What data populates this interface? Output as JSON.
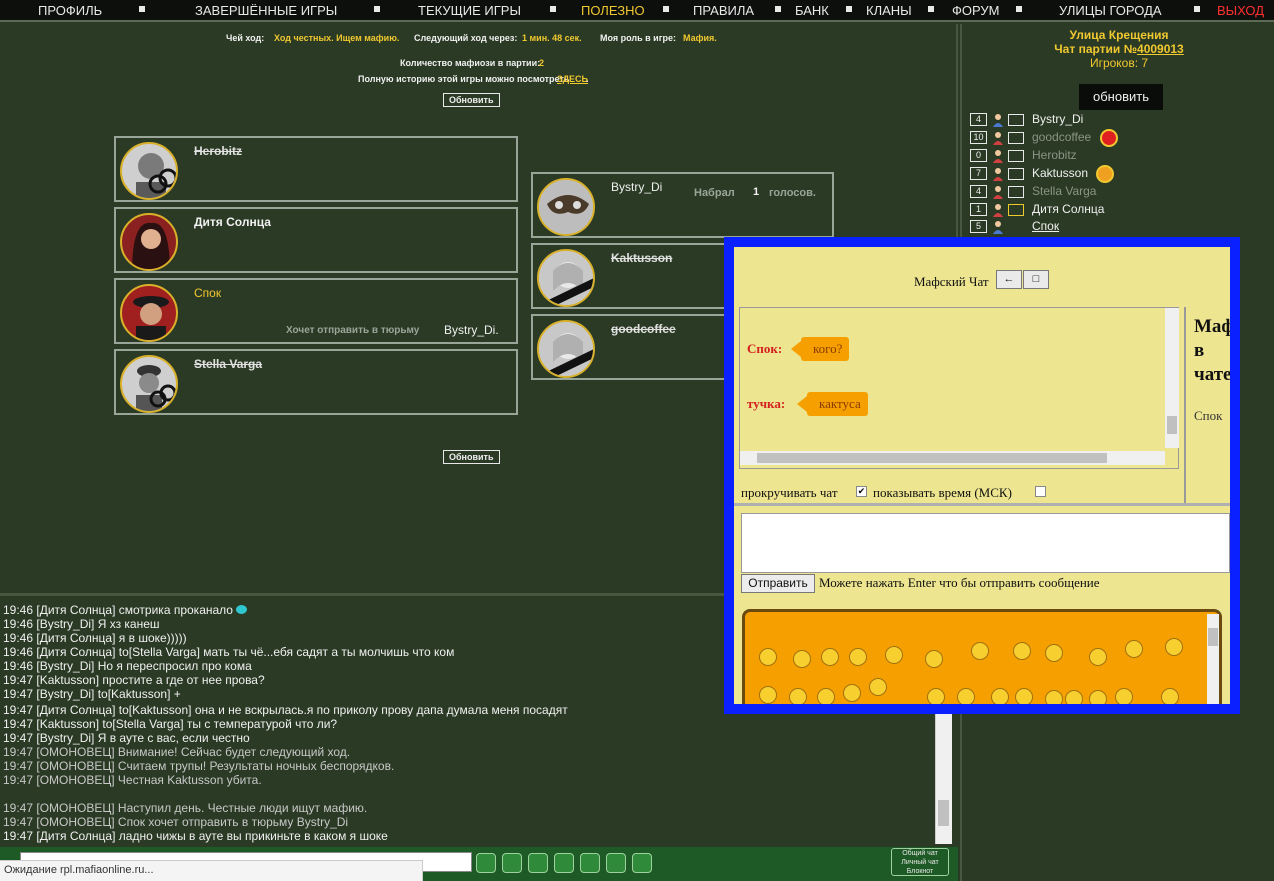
{
  "nav": {
    "items": [
      "ПРОФИЛЬ",
      "ЗАВЕРШЁННЫЕ ИГРЫ",
      "ТЕКУЩИЕ ИГРЫ",
      "ПОЛЕЗНО",
      "ПРАВИЛА",
      "БАНК",
      "КЛАНЫ",
      "ФОРУМ",
      "УЛИЦЫ ГОРОДА",
      "ВЫХОД"
    ],
    "active_color": "#f0c830",
    "exit_color": "#ff3030"
  },
  "game": {
    "turn_label": "Чей ход:",
    "turn_value": "Ход честных. Ищем мафию.",
    "next_label": "Следующий ход через:",
    "next_value": "1 мин. 48 сек.",
    "role_label": "Моя роль в игре:",
    "role_value": "Мафия.",
    "mafia_count_label": "Количество мафиози в партии:",
    "mafia_count_value": "2",
    "history_text": "Полную историю этой игры можно посмотреть",
    "history_link": "ЗДЕСЬ",
    "history_dot": ".",
    "refresh_label": "Обновить"
  },
  "players_left": [
    {
      "name": "Herobitz",
      "dead": true
    },
    {
      "name": "Дитя Солнца",
      "dead": false
    },
    {
      "name": "Спок",
      "dead": false,
      "self": true,
      "action": "Хочет отправить в тюрьму",
      "target": "Bystry_Di."
    },
    {
      "name": "Stella Varga",
      "dead": true
    }
  ],
  "players_right": [
    {
      "name": "Bystry_Di",
      "dead": false,
      "votes_label": "Набрал",
      "votes": "1",
      "votes_suffix": "голосов."
    },
    {
      "name": "Kaktusson",
      "dead": true
    },
    {
      "name": "goodcoffee",
      "dead": true
    }
  ],
  "right_panel": {
    "street": "Улица Крещения",
    "party_label": "Чат партии №",
    "party_number": "4009013",
    "players_count": "Игроков: 7",
    "refresh_label": "обновить",
    "players": [
      {
        "num": "4",
        "name": "Bystry_Di",
        "dead": false
      },
      {
        "num": "10",
        "name": "goodcoffee",
        "dead": true
      },
      {
        "num": "0",
        "name": "Herobitz",
        "dead": true
      },
      {
        "num": "7",
        "name": "Kaktusson",
        "dead": false
      },
      {
        "num": "4",
        "name": "Stella Varga",
        "dead": true
      },
      {
        "num": "1",
        "name": "Дитя Солнца",
        "dead": false
      },
      {
        "num": "5",
        "name": "Спок",
        "dead": false
      }
    ]
  },
  "chat": {
    "lines": [
      {
        "text": "19:46 [Дитя Солнца] смотрика проканало",
        "sys": false
      },
      {
        "text": "19:46 [Bystry_Di] Я хз канеш",
        "sys": false
      },
      {
        "text": "19:46 [Дитя Солнца] я в шоке)))))",
        "sys": false
      },
      {
        "text": "19:46 [Дитя Солнца] to[Stella Varga] мать ты чё...ебя садят а ты молчишь что ком",
        "sys": false
      },
      {
        "text": "19:46 [Bystry_Di] Но я переспросил про кома",
        "sys": false
      },
      {
        "text": "19:47 [Kaktusson] простите а где от нее прова?",
        "sys": false
      },
      {
        "text": "19:47 [Bystry_Di] to[Kaktusson] +",
        "sys": false
      },
      {
        "text": "19:47 [Дитя Солнца] to[Kaktusson] она и не вскрылась.я по приколу прову дапа думала меня посадят",
        "sys": false
      },
      {
        "text": "19:47 [Kaktusson] to[Stella Varga] ты с температурой что ли?",
        "sys": false
      },
      {
        "text": "19:47 [Bystry_Di] Я в ауте с вас, если честно",
        "sys": false
      },
      {
        "text": "19:47 [ОМОНОВЕЦ] Внимание! Сейчас будет следующий ход.",
        "sys": true
      },
      {
        "text": "19:47 [ОМОНОВЕЦ] Считаем трупы! Результаты ночных беспорядков.",
        "sys": true
      },
      {
        "text": "19:47 [ОМОНОВЕЦ] Честная Kaktusson убита.",
        "sys": true
      },
      {
        "text": "",
        "sys": true
      },
      {
        "text": "19:47 [ОМОНОВЕЦ] Наступил день. Честные люди ищут мафию.",
        "sys": true
      },
      {
        "text": "19:47 [ОМОНОВЕЦ] Спок хочет отправить в тюрьму Bystry_Di",
        "sys": true
      },
      {
        "text": "19:47 [Дитя Солнца] ладно чижы в ауте вы прикиньте в каком я шоке",
        "sys": false
      }
    ]
  },
  "tabs": {
    "general": "Общий чат",
    "personal": "Личный чат",
    "notepad": "Блокнот"
  },
  "status": "Ожидание rpl.mafiaonline.ru...",
  "popup": {
    "title": "Мафский Чат",
    "back_btn": "←",
    "max_btn": "□",
    "messages": [
      {
        "who": "Спок:",
        "text": "кого?"
      },
      {
        "who": "тучка:",
        "text": "кактуса"
      }
    ],
    "side_title": "Маф в чате",
    "side_user": "Спок",
    "scroll_label": "прокручивать чат",
    "scroll_checked": "✔",
    "time_label": "показывать время (МСК)",
    "send_label": "Отправить",
    "send_hint": "Можете нажать Enter что бы отправить сообщение"
  }
}
